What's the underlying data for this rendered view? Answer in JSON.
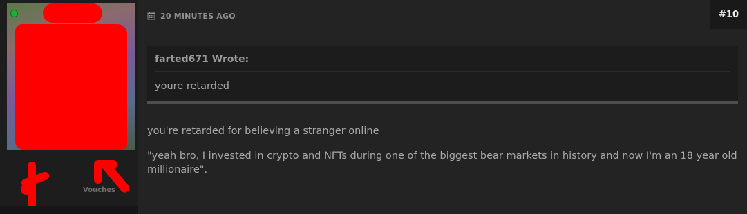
{
  "user": {
    "online_status": "online",
    "stats": [
      {
        "label": ""
      },
      {
        "label": "Vouches"
      }
    ]
  },
  "post": {
    "time_icon": "calendar-icon",
    "time": "20 MINUTES AGO",
    "number": "#10",
    "quote": {
      "author_line": "farted671 Wrote:",
      "text": "youre retarded"
    },
    "paragraphs": [
      "you're retarded for believing a stranger online",
      "\"yeah bro, I invested in crypto and NFTs during one of the biggest bear markets in history and now I'm an 18 year old millionaire\"."
    ]
  },
  "colors": {
    "redaction": "#ff0000",
    "online": "#1db233",
    "background": "#232323"
  }
}
